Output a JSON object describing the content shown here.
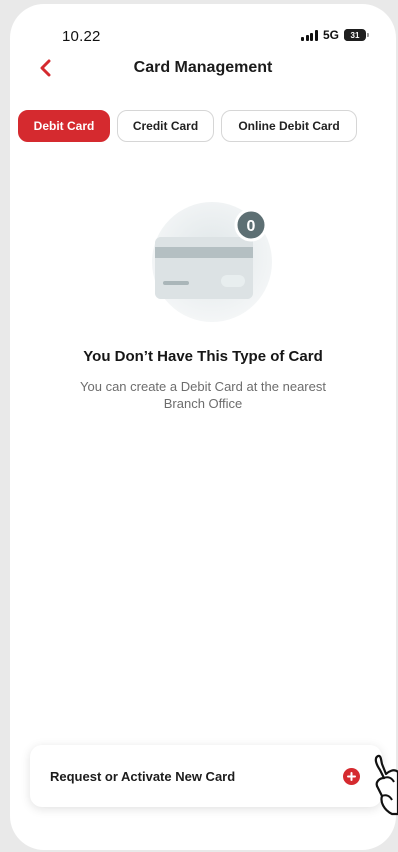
{
  "status_bar": {
    "time": "10.22",
    "network": "5G",
    "battery": "31",
    "battery_fraction": 0.31
  },
  "header": {
    "title": "Card Management",
    "back_icon": "chevron-left-icon"
  },
  "tabs": [
    {
      "label": "Debit Card",
      "active": true
    },
    {
      "label": "Credit Card",
      "active": false
    },
    {
      "label": "Online Debit Card",
      "active": false
    }
  ],
  "empty_state": {
    "badge_count": "0",
    "title": "You Don’t Have This Type of Card",
    "description": "You can create a Debit Card at the nearest Branch Office",
    "icon": "card-illustration-icon"
  },
  "action": {
    "label": "Request or Activate New Card",
    "icon": "plus-circle-icon"
  },
  "colors": {
    "accent": "#d52a2f",
    "text_primary": "#1b1b1b",
    "text_secondary": "#6d6d6d"
  }
}
